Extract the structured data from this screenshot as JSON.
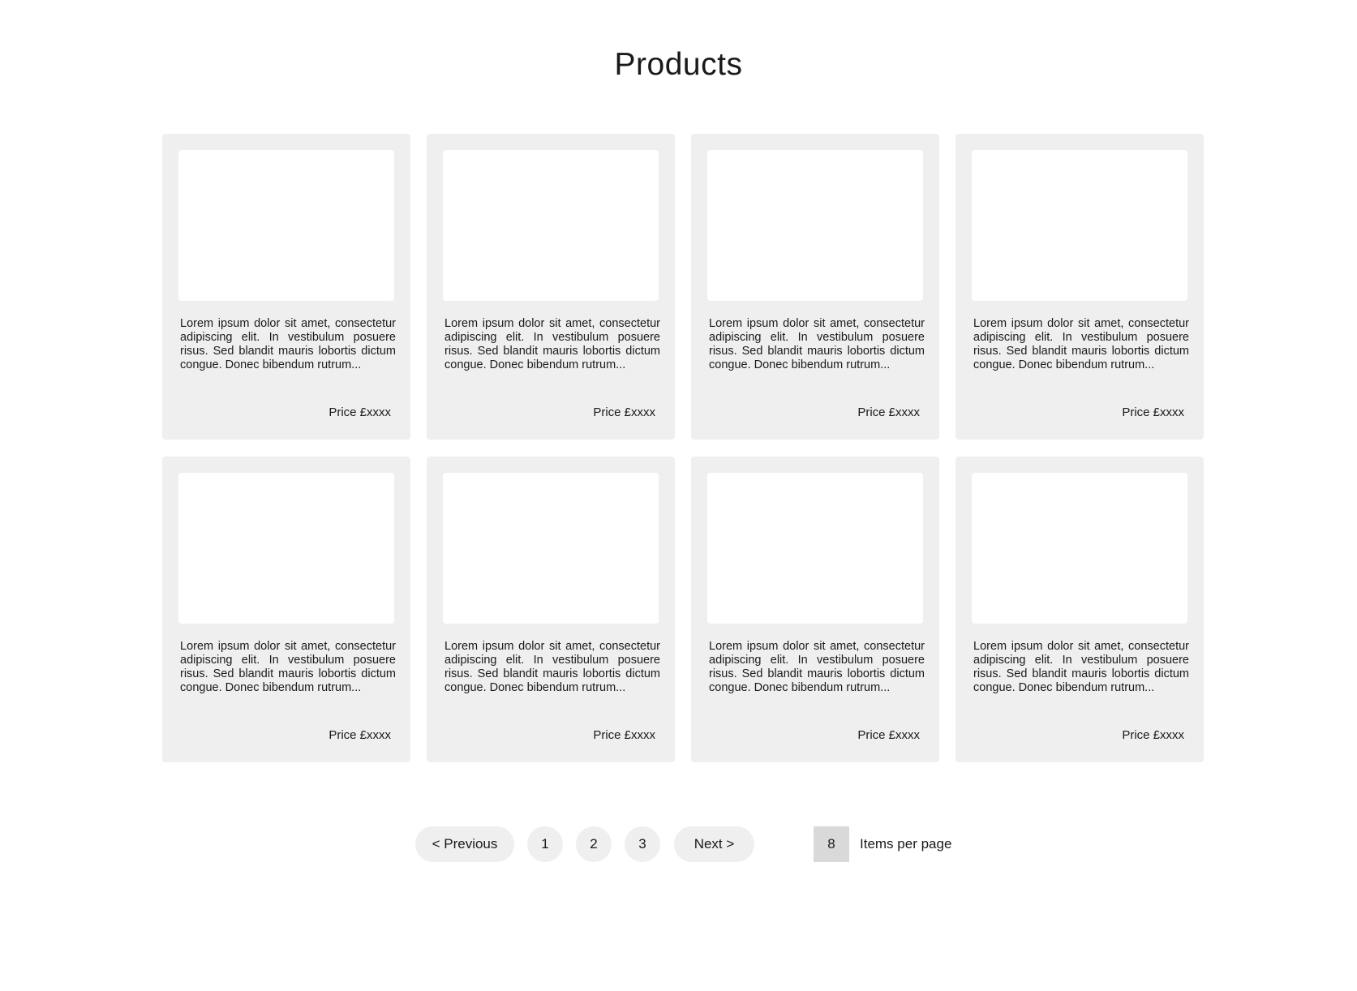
{
  "page": {
    "title": "Products"
  },
  "products": [
    {
      "description": "Lorem ipsum dolor sit amet, consectetur adipiscing elit. In vestibulum posuere risus. Sed blandit mauris lobortis dictum congue. Donec bibendum rutrum...",
      "price": "Price £xxxx"
    },
    {
      "description": "Lorem ipsum dolor sit amet, consectetur adipiscing elit. In vestibulum posuere risus. Sed blandit mauris lobortis dictum congue. Donec bibendum rutrum...",
      "price": "Price £xxxx"
    },
    {
      "description": "Lorem ipsum dolor sit amet, consectetur adipiscing elit. In vestibulum posuere risus. Sed blandit mauris lobortis dictum congue. Donec bibendum rutrum...",
      "price": "Price £xxxx"
    },
    {
      "description": "Lorem ipsum dolor sit amet, consectetur adipiscing elit. In vestibulum posuere risus. Sed blandit mauris lobortis dictum congue. Donec bibendum rutrum...",
      "price": "Price £xxxx"
    },
    {
      "description": "Lorem ipsum dolor sit amet, consectetur adipiscing elit. In vestibulum posuere risus. Sed blandit mauris lobortis dictum congue. Donec bibendum rutrum...",
      "price": "Price £xxxx"
    },
    {
      "description": "Lorem ipsum dolor sit amet, consectetur adipiscing elit. In vestibulum posuere risus. Sed blandit mauris lobortis dictum congue. Donec bibendum rutrum...",
      "price": "Price £xxxx"
    },
    {
      "description": "Lorem ipsum dolor sit amet, consectetur adipiscing elit. In vestibulum posuere risus. Sed blandit mauris lobortis dictum congue. Donec bibendum rutrum...",
      "price": "Price £xxxx"
    },
    {
      "description": "Lorem ipsum dolor sit amet, consectetur adipiscing elit. In vestibulum posuere risus. Sed blandit mauris lobortis dictum congue. Donec bibendum rutrum...",
      "price": "Price £xxxx"
    }
  ],
  "pagination": {
    "previous_label": "< Previous",
    "pages": [
      "1",
      "2",
      "3"
    ],
    "next_label": "Next >"
  },
  "items_per_page": {
    "value": "8",
    "label": "Items per page"
  },
  "colors": {
    "card_background": "#efefef",
    "image_placeholder": "#ffffff",
    "pill_background": "#efefef",
    "per_page_background": "#d9d9d9",
    "text": "#1a1a1a"
  }
}
